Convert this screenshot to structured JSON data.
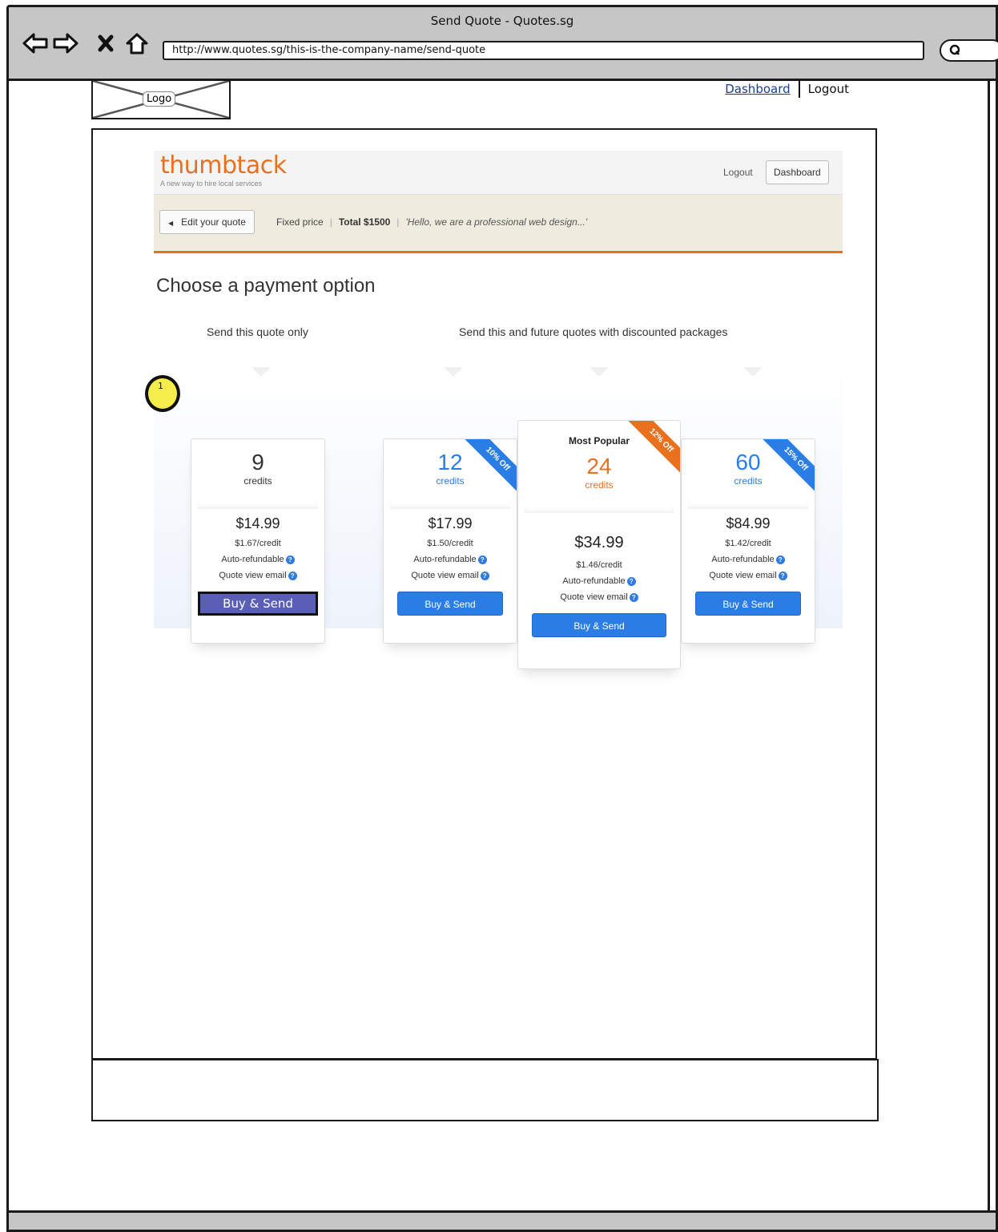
{
  "window": {
    "title": "Send Quote - Quotes.sg"
  },
  "browser": {
    "url": "http://www.quotes.sg/this-is-the-company-name/send-quote"
  },
  "wireframe": {
    "logo_label": "Logo",
    "nav": {
      "dashboard": "Dashboard",
      "logout": "Logout"
    },
    "annotation": "1"
  },
  "thumbtack": {
    "brand": "thumbtack",
    "tagline": "A new way to hire local services",
    "header": {
      "logout": "Logout",
      "dashboard": "Dashboard"
    },
    "bar": {
      "edit_label": "Edit your quote",
      "pricing_type": "Fixed price",
      "total": "Total $1500",
      "message": "'Hello, we are a professional web design...'"
    },
    "heading": "Choose a payment option",
    "section_single": "Send this quote only",
    "section_packages": "Send this and future quotes with discounted packages",
    "plans": [
      {
        "credits": "9",
        "credits_label": "credits",
        "price": "$14.99",
        "per_credit": "$1.67/credit",
        "refund": "Auto-refundable",
        "email": "Quote view email",
        "button": "Buy & Send"
      },
      {
        "credits": "12",
        "credits_label": "credits",
        "price": "$17.99",
        "per_credit": "$1.50/credit",
        "refund": "Auto-refundable",
        "email": "Quote view email",
        "button": "Buy & Send",
        "ribbon": "10% Off"
      },
      {
        "badge": "Most Popular",
        "credits": "24",
        "credits_label": "credits",
        "price": "$34.99",
        "per_credit": "$1.46/credit",
        "refund": "Auto-refundable",
        "email": "Quote view email",
        "button": "Buy & Send",
        "ribbon": "12% Off"
      },
      {
        "credits": "60",
        "credits_label": "credits",
        "price": "$84.99",
        "per_credit": "$1.42/credit",
        "refund": "Auto-refundable",
        "email": "Quote view email",
        "button": "Buy & Send",
        "ribbon": "15% Off"
      }
    ],
    "help_icon": "?"
  },
  "colors": {
    "brand_orange": "#e8701f",
    "button_blue": "#2b7de6",
    "selected_button": "#5b5eb7",
    "annotation_yellow": "#f4ed4a",
    "chrome_gray": "#c6c6c6"
  },
  "icons": [
    "back-arrow-icon",
    "forward-arrow-icon",
    "stop-icon",
    "home-icon",
    "search-icon",
    "help-icon",
    "left-triangle-icon"
  ]
}
